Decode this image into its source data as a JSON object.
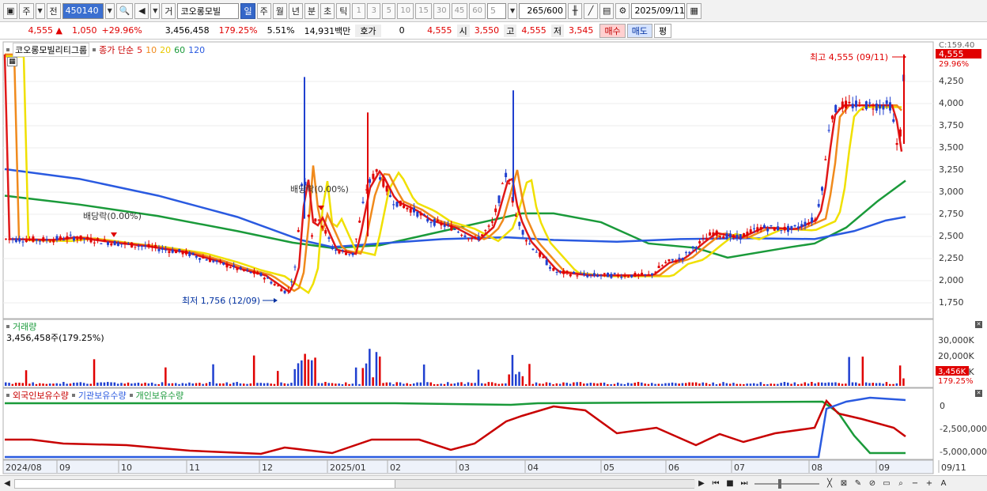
{
  "toolbar": {
    "period_label": "주",
    "prev_label": "전",
    "stock_code": "450140",
    "trade_label": "거",
    "stock_name": "코오롱모빌",
    "intervals": [
      "일",
      "주",
      "월",
      "년",
      "분",
      "초",
      "틱"
    ],
    "active_interval": "일",
    "minute_options": [
      "1",
      "3",
      "5",
      "10",
      "15",
      "30",
      "45",
      "60"
    ],
    "count_select": "5",
    "range_value": "265",
    "range_max": "/600",
    "date": "2025/09/11"
  },
  "quote": {
    "price": "4,555",
    "change": "1,050",
    "change_pct": "+29.96%",
    "volume": "3,456,458",
    "volume_ratio": "179.25%",
    "turnover_rate": "5.51%",
    "trade_value": "14,931백만",
    "hoga_label": "호가",
    "hoga_value": "0",
    "current": "4,555",
    "open_label": "시",
    "open": "3,550",
    "high_label": "고",
    "high": "4,555",
    "low_label": "저",
    "low": "3,545",
    "buy_label": "매수",
    "sell_label": "매도",
    "avg_label": "평"
  },
  "price_panel": {
    "stock_title": "코오롱모빌리티그룹",
    "ma_label": "종가 단순",
    "ma_periods": [
      {
        "period": "5",
        "color": "#e01818"
      },
      {
        "period": "10",
        "color": "#f08a1c"
      },
      {
        "period": "20",
        "color": "#f0e000"
      },
      {
        "period": "60",
        "color": "#1a9a3a"
      },
      {
        "period": "120",
        "color": "#2a5ae0"
      }
    ],
    "y_ticks": [
      "4,250",
      "4,000",
      "3,750",
      "3,500",
      "3,250",
      "3,000",
      "2,750",
      "2,500",
      "2,250",
      "2,000",
      "1,750"
    ],
    "y_top_label": "C:159.40",
    "price_badge": "4,555",
    "pct_badge": "29.96%",
    "high_annotation": "최고 4,555 (09/11)",
    "low_annotation": "최저 1,756 (12/09)",
    "div_label_1": "배당락(0.00%)",
    "div_label_2": "배당락(0.00%)"
  },
  "volume_panel": {
    "title": "거래량",
    "value": "3,456,458주(179.25%)",
    "y_ticks": [
      "30,000K",
      "20,000K",
      "10,000K"
    ],
    "badge": "3,456K",
    "pct": "179.25%"
  },
  "holding_panel": {
    "legend": [
      "외국인보유수량",
      "기관보유수량",
      "개인보유수량"
    ],
    "legend_colors": [
      "#c80000",
      "#2a5ae0",
      "#1a9a3a"
    ],
    "y_ticks": [
      "0",
      "-2,500,000",
      "-5,000,000"
    ]
  },
  "x_axis": [
    "2024/08",
    "09",
    "10",
    "11",
    "12",
    "2025/01",
    "02",
    "03",
    "04",
    "05",
    "06",
    "07",
    "08",
    "09",
    "09/11"
  ]
}
